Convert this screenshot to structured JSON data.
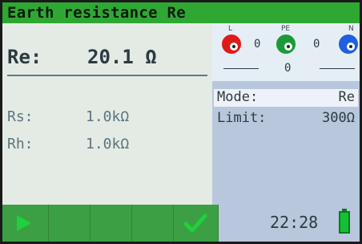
{
  "title": "Earth resistance Re",
  "main": {
    "label": "Re:",
    "value": "20.1 Ω"
  },
  "readings": [
    {
      "label": "Rs:",
      "value": "1.0kΩ"
    },
    {
      "label": "Rh:",
      "value": "1.0kΩ"
    }
  ],
  "terminals": {
    "l": {
      "tag": "L",
      "color": "#e01a1a"
    },
    "pe": {
      "tag": "PE",
      "color": "#1a9a3a"
    },
    "n": {
      "tag": "N",
      "color": "#1f5fe0"
    },
    "l_pe_value": "0",
    "pe_n_value": "0",
    "l_n_value": "0"
  },
  "params": {
    "mode": {
      "label": "Mode:",
      "value": "Re"
    },
    "limit": {
      "label": "Limit:",
      "value": "300Ω"
    }
  },
  "footer": {
    "start_icon": "play-icon",
    "confirm_icon": "checkmark-icon",
    "time": "22:28",
    "battery_icon": "battery-icon"
  }
}
